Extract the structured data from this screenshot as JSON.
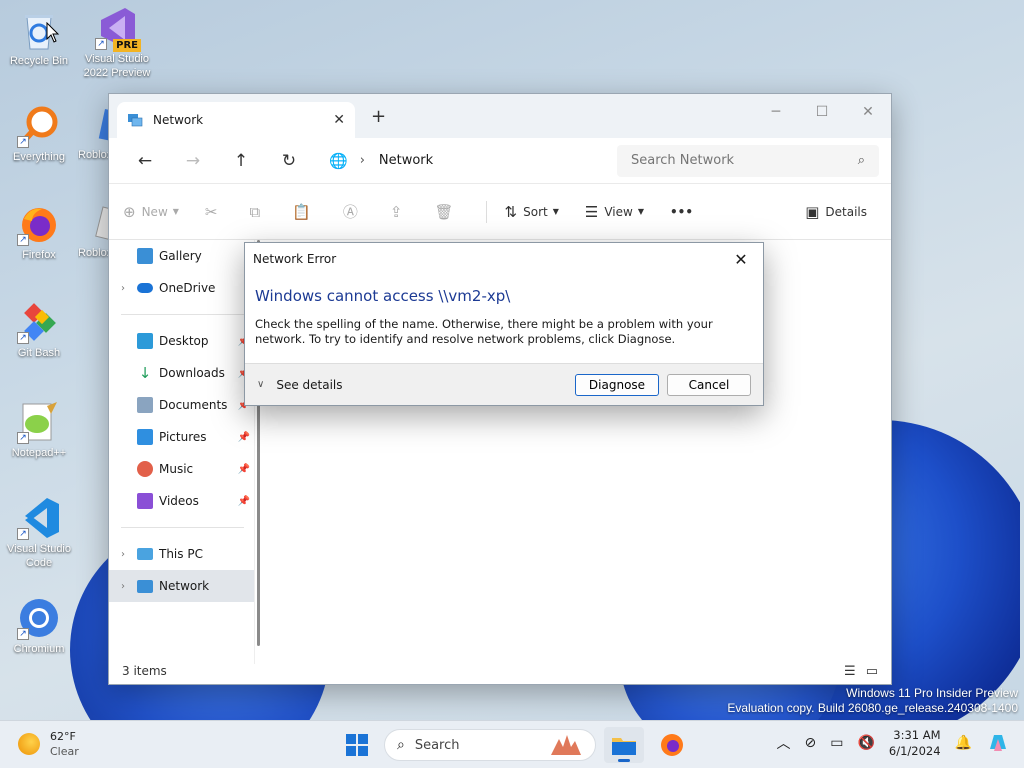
{
  "desktop": {
    "icons": [
      {
        "label": "Recycle Bin"
      },
      {
        "label": "Visual Studio 2022 Preview",
        "badge": "PRE"
      },
      {
        "label": "Everything"
      },
      {
        "label": "Roblox"
      },
      {
        "label": "Firefox"
      },
      {
        "label": "Roblox"
      },
      {
        "label": "Git Bash"
      },
      {
        "label": "Notepad++"
      },
      {
        "label": "Visual Studio Code"
      },
      {
        "label": "Chromium"
      }
    ],
    "watermark": {
      "line1": "Windows 11 Pro Insider Preview",
      "line2": "Evaluation copy. Build 26080.ge_release.240308-1400"
    }
  },
  "explorer": {
    "tab_title": "Network",
    "new_tab": "+",
    "address": {
      "location": "Network"
    },
    "search": {
      "placeholder": "Search Network"
    },
    "toolbar": {
      "new_label": "New",
      "sort_label": "Sort",
      "view_label": "View",
      "more_label": "•••",
      "details_label": "Details"
    },
    "sidebar": {
      "gallery": "Gallery",
      "onedrive": "OneDrive",
      "desktop": "Desktop",
      "downloads": "Downloads",
      "documents": "Documents",
      "pictures": "Pictures",
      "music": "Music",
      "videos": "Videos",
      "thispc": "This PC",
      "network": "Network"
    },
    "status": {
      "count": "3 items"
    }
  },
  "dialog": {
    "title": "Network Error",
    "heading": "Windows cannot access \\\\vm2-xp\\",
    "message": "Check the spelling of the name. Otherwise, there might be a problem with your network. To try to identify and resolve network problems, click Diagnose.",
    "see_details": "See details",
    "diagnose": "Diagnose",
    "cancel": "Cancel"
  },
  "taskbar": {
    "weather": {
      "temp": "62°F",
      "condition": "Clear"
    },
    "search_label": "Search",
    "time": "3:31 AM",
    "date": "6/1/2024"
  },
  "colors": {
    "accent": "#1a66c9",
    "dialog_heading": "#1c3a94"
  }
}
